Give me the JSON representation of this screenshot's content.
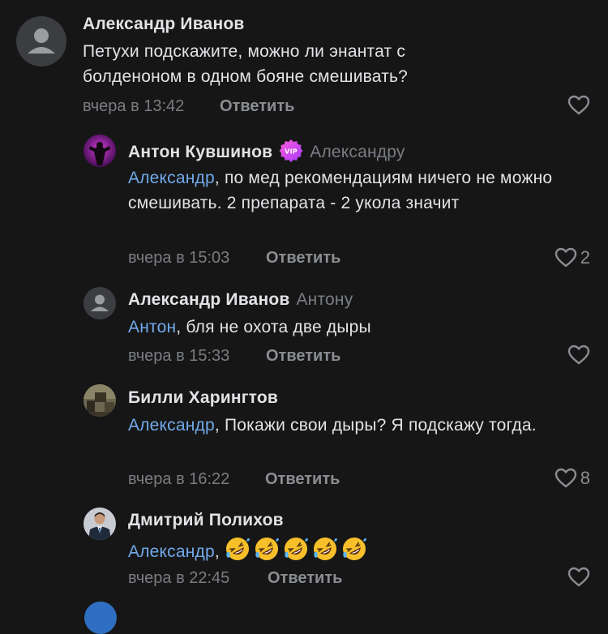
{
  "comments": [
    {
      "author": "Александр Иванов",
      "reply_to": "",
      "mention": "",
      "text": "Петухи подскажите, можно ли энантат с болденоном в одном бояне смешивать?",
      "time": "вчера в 13:42",
      "reply_label": "Ответить",
      "likes": "",
      "avatar_icon": "default-user-icon"
    },
    {
      "author": "Антон Кувшинов",
      "badge": "VIP",
      "reply_to": "Александру",
      "mention": "Александр",
      "text": ", по мед рекомендациям ничего не можно смешивать. 2 препарата - 2 укола значит",
      "time": "вчера в 15:03",
      "reply_label": "Ответить",
      "likes": "2",
      "avatar_icon": "bodybuilder-avatar"
    },
    {
      "author": "Александр Иванов",
      "reply_to": "Антону",
      "mention": "Антон",
      "text": ", бля не охота две дыры",
      "time": "вчера в 15:33",
      "reply_label": "Ответить",
      "likes": "",
      "avatar_icon": "default-user-icon"
    },
    {
      "author": "Билли Харингтов",
      "reply_to": "",
      "mention": "Александр",
      "text": ", Покажи свои дыры? Я подскажу тогда.",
      "time": "вчера в 16:22",
      "reply_label": "Ответить",
      "likes": "8",
      "avatar_icon": "room-photo-avatar"
    },
    {
      "author": "Дмитрий Полихов",
      "reply_to": "",
      "mention": "Александр",
      "text": ",",
      "emoji_count": 5,
      "emoji_icon": "rolling-on-floor-laughing-emoji",
      "time": "вчера в 22:45",
      "reply_label": "Ответить",
      "likes": "",
      "avatar_icon": "man-in-suit-avatar"
    }
  ],
  "colors": {
    "background": "#161616",
    "mention": "#71aaeb",
    "muted": "#7a7d82",
    "text": "#e1e3e6"
  }
}
